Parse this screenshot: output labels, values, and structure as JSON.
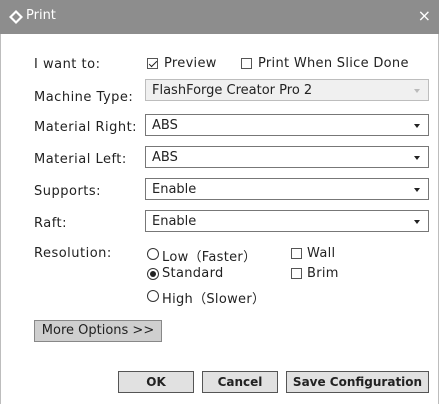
{
  "window": {
    "title": "Print",
    "close_glyph": "×",
    "icon": "app-diamond-icon"
  },
  "form": {
    "want_label": "I want to:",
    "preview_label": "Preview",
    "preview_checked": true,
    "print_when_done_label": "Print When Slice Done",
    "print_when_done_checked": false,
    "machine_type_label": "Machine Type:",
    "machine_type_value": "FlashForge Creator Pro 2",
    "material_right_label": "Material Right:",
    "material_right_value": "ABS",
    "material_left_label": "Material Left:",
    "material_left_value": "ABS",
    "supports_label": "Supports:",
    "supports_value": "Enable",
    "raft_label": "Raft:",
    "raft_value": "Enable",
    "resolution_label": "Resolution:",
    "resolution_options": [
      {
        "label": "Low（Faster）",
        "selected": false
      },
      {
        "label": "Standard",
        "selected": true
      },
      {
        "label": "High（Slower）",
        "selected": false
      }
    ],
    "wall_label": "Wall",
    "brim_label": "Brim"
  },
  "buttons": {
    "more_options": "More Options >>",
    "ok": "OK",
    "cancel": "Cancel",
    "save_configuration": "Save Configuration"
  }
}
